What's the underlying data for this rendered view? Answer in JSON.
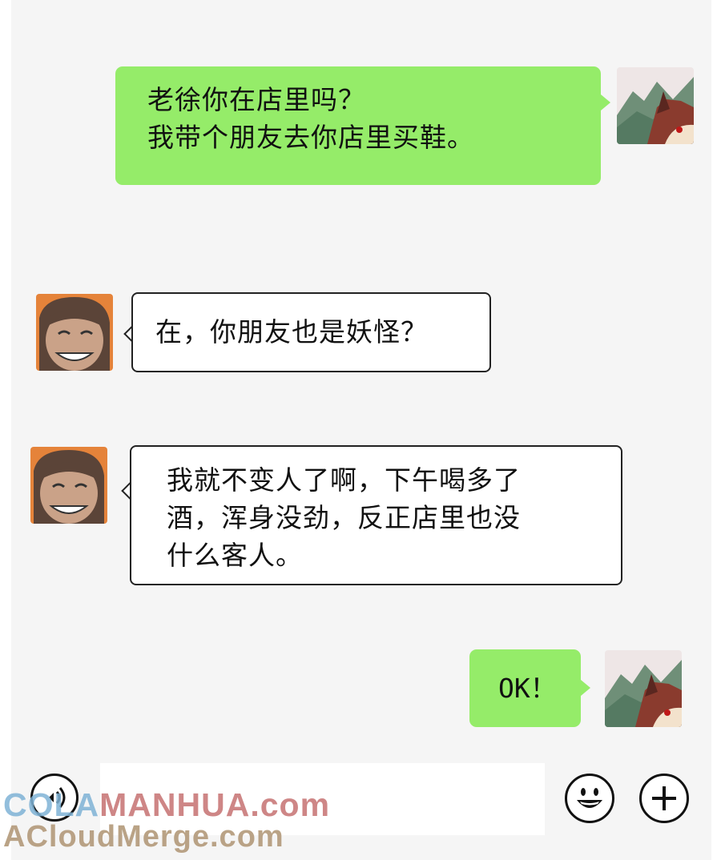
{
  "messages": [
    {
      "side": "right",
      "sender": "self",
      "avatar_icon": "landscape-character-avatar-icon",
      "lines": [
        "老徐你在店里吗？",
        "我带个朋友去你店里买鞋。"
      ]
    },
    {
      "side": "left",
      "sender": "old-xu",
      "avatar_icon": "smiling-man-avatar-icon",
      "lines": [
        "在，你朋友也是妖怪？"
      ]
    },
    {
      "side": "left",
      "sender": "old-xu",
      "avatar_icon": "smiling-man-avatar-icon",
      "lines": [
        "我就不变人了啊，下午喝多了",
        "酒，浑身没劲，反正店里也没",
        "什么客人。"
      ]
    },
    {
      "side": "right",
      "sender": "self",
      "avatar_icon": "landscape-character-avatar-icon",
      "lines": [
        "OK！"
      ]
    }
  ],
  "input_bar": {
    "voice_icon": "voice-icon",
    "emoji_icon": "emoji-icon",
    "plus_icon": "plus-icon",
    "text_value": ""
  },
  "watermarks": {
    "line1_part_a": "COLA",
    "line1_part_b": "MANHUA.com",
    "line2": "ACloudMerge.com"
  },
  "colors": {
    "self_bubble": "#95ec69",
    "other_bubble": "#ffffff",
    "chat_background": "#f5f5f5"
  }
}
